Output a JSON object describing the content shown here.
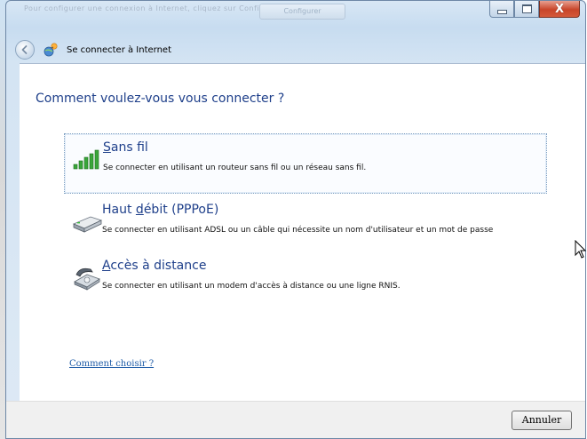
{
  "window": {
    "title": "Se connecter à Internet",
    "background_text_1": "Pour configurer une connexion à Internet, cliquez sur Configurer.",
    "background_text_2": "",
    "background_button": "Configurer",
    "controls": {
      "minimize": "minimize-icon",
      "maximize": "maximize-icon",
      "close": "X"
    }
  },
  "nav": {
    "back_icon": "back-arrow-icon",
    "app_icon": "network-globe-icon"
  },
  "main": {
    "heading": "Comment voulez-vous vous connecter ?",
    "options": [
      {
        "id": "wireless",
        "title_underline": "S",
        "title_rest": "ans fil",
        "description": "Se connecter en utilisant un routeur sans fil ou un réseau sans fil.",
        "icon": "wireless-signal-icon",
        "selected": true
      },
      {
        "id": "broadband",
        "title_before": "Haut ",
        "title_underline": "d",
        "title_after": "ébit (PPPoE)",
        "description": "Se connecter en utilisant ADSL ou un câble qui nécessite un nom d'utilisateur et un mot de passe",
        "icon": "broadband-modem-icon",
        "selected": false
      },
      {
        "id": "dialup",
        "title_underline": "A",
        "title_rest": "ccès à distance",
        "description": "Se connecter en utilisant un modem d'accès à distance ou une ligne RNIS.",
        "icon": "dialup-phone-icon",
        "selected": false
      }
    ],
    "help_link": "Comment choisir ?"
  },
  "footer": {
    "cancel_label": "Annuler"
  },
  "colors": {
    "heading": "#1e3f8a",
    "link": "#1c5aa6",
    "frame": "#6d87a6",
    "close": "#c8452a"
  }
}
